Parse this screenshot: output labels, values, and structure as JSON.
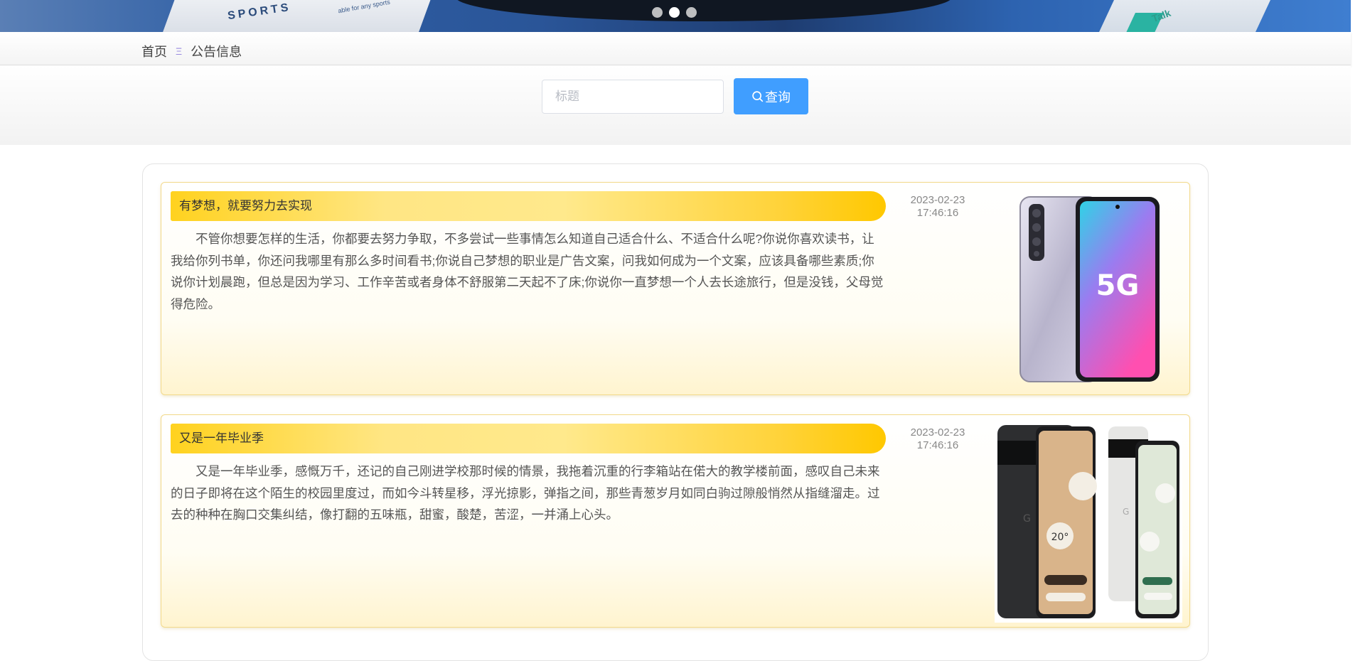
{
  "banner": {
    "card_text": "SPORTS",
    "card_small_text": "able for any sports",
    "right_text": "Talk",
    "carousel_dots": 3,
    "active_dot": 1
  },
  "breadcrumb": {
    "home": "首页",
    "separator": "Ξ",
    "current": "公告信息"
  },
  "search": {
    "placeholder": "标题",
    "value": "",
    "button_label": "查询",
    "button_color": "#409eff"
  },
  "notices": [
    {
      "title": "有梦想，就要努力去实现",
      "content": "不管你想要怎样的生活，你都要去努力争取，不多尝试一些事情怎么知道自己适合什么、不适合什么呢?你说你喜欢读书，让我给你列书单，你还问我哪里有那么多时间看书;你说自己梦想的职业是广告文案，问我如何成为一个文案，应该具备哪些素质;你说你计划晨跑，但总是因为学习、工作辛苦或者身体不舒服第二天起不了床;你说你一直梦想一个人去长途旅行，但是没钱，父母觉得危险。",
      "date": "2023-02-23",
      "time": "17:46:16",
      "image_text": "5G"
    },
    {
      "title": "又是一年毕业季",
      "content": "又是一年毕业季，感慨万千，还记的自己刚进学校那时候的情景，我拖着沉重的行李箱站在偌大的教学楼前面，感叹自己未来的日子即将在这个陌生的校园里度过，而如今斗转星移，浮光掠影，弹指之间，那些青葱岁月如同白驹过隙般悄然从指缝溜走。过去的种种在胸口交集纠结，像打翻的五味瓶，甜蜜，酸楚，苦涩，一并涌上心头。",
      "date": "2023-02-23",
      "time": "17:46:16",
      "image_text": "20°"
    }
  ]
}
